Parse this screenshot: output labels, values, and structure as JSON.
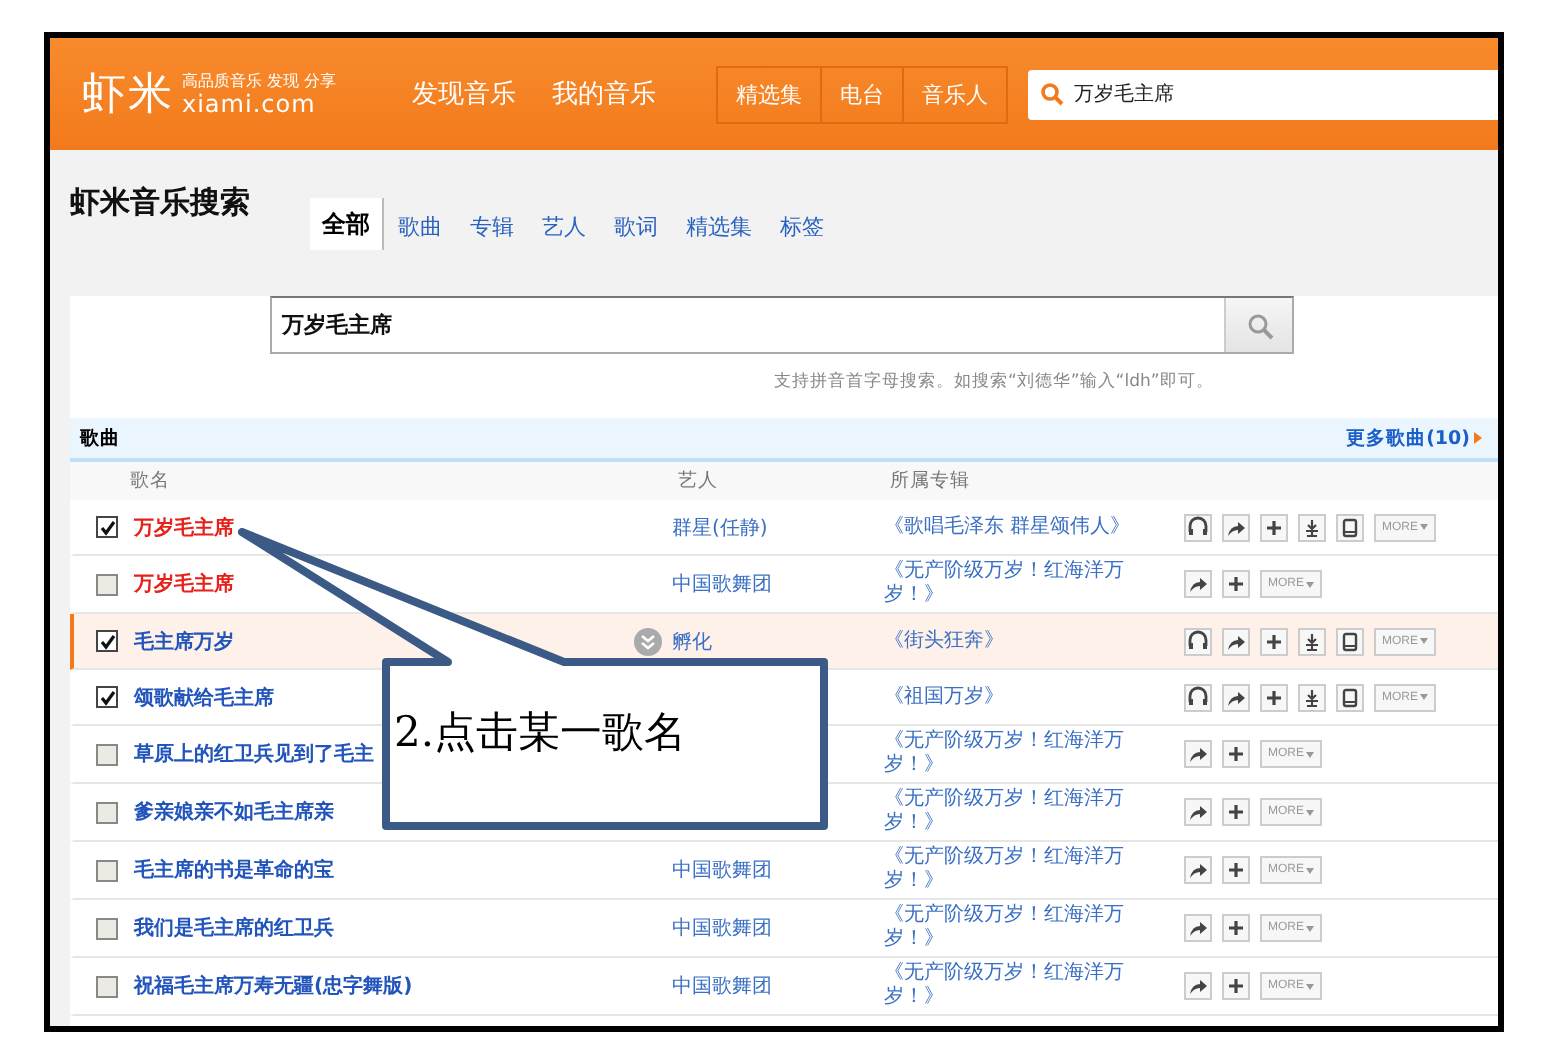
{
  "header": {
    "logo": "虾米",
    "slogan": "高品质音乐 发现 分享",
    "domain": "xiami.com",
    "nav": [
      "发现音乐",
      "我的音乐"
    ],
    "nav_group": [
      "精选集",
      "电台",
      "音乐人"
    ],
    "search_value": "万岁毛主席"
  },
  "page_title": "虾米音乐搜索",
  "tabs": [
    {
      "label": "全部",
      "selected": true
    },
    {
      "label": "歌曲",
      "selected": false
    },
    {
      "label": "专辑",
      "selected": false
    },
    {
      "label": "艺人",
      "selected": false
    },
    {
      "label": "歌词",
      "selected": false
    },
    {
      "label": "精选集",
      "selected": false
    },
    {
      "label": "标签",
      "selected": false
    }
  ],
  "search": {
    "value": "万岁毛主席",
    "hint": "支持拼音首字母搜索。如搜索“刘德华”输入“ldh”即可。"
  },
  "songs": {
    "title": "歌曲",
    "more_link": "更多歌曲(10)",
    "columns": [
      "歌名",
      "艺人",
      "所属专辑"
    ],
    "rows": [
      {
        "name": "万岁毛主席",
        "color": "#e8201a",
        "checked": true,
        "selected": false,
        "artist": "群星(任静)",
        "album": "《歌唱毛泽东 群星颂伟人》",
        "kind": "full",
        "more": "MORE"
      },
      {
        "name": "万岁毛主席",
        "color": "#e8201a",
        "checked": false,
        "selected": false,
        "artist": "中国歌舞团",
        "album": "《无产阶级万岁！红海洋万岁！》",
        "kind": "short",
        "more": "MORE"
      },
      {
        "name": "毛主席万岁",
        "color": "#2255bb",
        "checked": true,
        "selected": true,
        "artist": "孵化",
        "album": "《街头狂奔》",
        "kind": "full",
        "more": "MORE"
      },
      {
        "name": "颂歌献给毛主席",
        "color": "#2255bb",
        "checked": true,
        "selected": false,
        "album": "《祖国万岁》",
        "kind": "full",
        "more": "MORE"
      },
      {
        "name": "草原上的红卫兵见到了毛主",
        "color": "#2255bb",
        "checked": false,
        "selected": false,
        "album": "《无产阶级万岁！红海洋万岁！》",
        "kind": "short",
        "more": "MORE"
      },
      {
        "name": "爹亲娘亲不如毛主席亲",
        "color": "#2255bb",
        "checked": false,
        "selected": false,
        "album": "《无产阶级万岁！红海洋万岁！》",
        "kind": "short",
        "more": "MORE"
      },
      {
        "name": "毛主席的书是革命的宝",
        "color": "#2255bb",
        "checked": false,
        "selected": false,
        "artist": "中国歌舞团",
        "album": "《无产阶级万岁！红海洋万岁！》",
        "kind": "short",
        "more": "MORE"
      },
      {
        "name": "我们是毛主席的红卫兵",
        "color": "#2255bb",
        "checked": false,
        "selected": false,
        "artist": "中国歌舞团",
        "album": "《无产阶级万岁！红海洋万岁！》",
        "kind": "short",
        "more": "MORE"
      },
      {
        "name": "祝福毛主席万寿无疆(忠字舞版)",
        "color": "#2255bb",
        "checked": false,
        "selected": false,
        "artist": "中国歌舞团",
        "album": "《无产阶级万岁！红海洋万岁！》",
        "kind": "short",
        "more": "MORE"
      }
    ]
  },
  "callout": {
    "text": "2.点击某一歌名"
  }
}
